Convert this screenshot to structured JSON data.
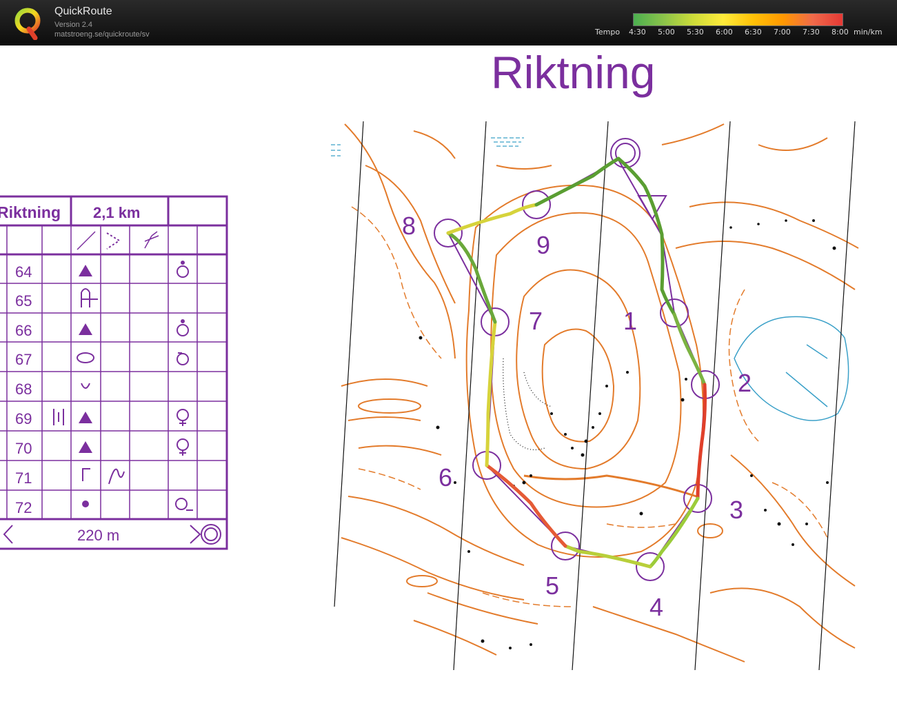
{
  "app": {
    "title": "QuickRoute",
    "version": "Version 2.4",
    "url": "matstroeng.se/quickroute/sv"
  },
  "tempo_scale": {
    "label": "Tempo",
    "ticks": [
      "4:30",
      "5:00",
      "5:30",
      "6:00",
      "6:30",
      "7:00",
      "7:30",
      "8:00"
    ],
    "unit": "min/km",
    "colors": [
      "#4caf50",
      "#8bc34a",
      "#cddc39",
      "#ffeb3b",
      "#ffc107",
      "#ff9800",
      "#f06a4a",
      "#e53935"
    ]
  },
  "map": {
    "title": "Riktning",
    "colors": {
      "course": "#7b2f9e",
      "contour": "#e37b2b",
      "water": "#3aa0c8",
      "route_fast": "#3f8f2a",
      "route_mid": "#d8d53a",
      "route_slow": "#e02a2a"
    },
    "controls": [
      "1",
      "2",
      "3",
      "4",
      "5",
      "6",
      "7",
      "8",
      "9"
    ]
  },
  "description_sheet": {
    "course_name": "Riktning",
    "length": "2,1 km",
    "finish_distance": "220 m",
    "rows": [
      {
        "code": "64",
        "feature": "knoll",
        "detail": "○·"
      },
      {
        "code": "65",
        "feature": "reentrant",
        "detail": ""
      },
      {
        "code": "66",
        "feature": "knoll",
        "detail": "○·"
      },
      {
        "code": "67",
        "feature": "depression",
        "detail": "○"
      },
      {
        "code": "68",
        "feature": "pit",
        "detail": ""
      },
      {
        "code": "69",
        "feature": "knoll",
        "detail": "♀"
      },
      {
        "code": "70",
        "feature": "knoll",
        "detail": "♀"
      },
      {
        "code": "71",
        "feature": "corner",
        "detail": ""
      },
      {
        "code": "72",
        "feature": "dot",
        "detail": "○"
      }
    ]
  }
}
